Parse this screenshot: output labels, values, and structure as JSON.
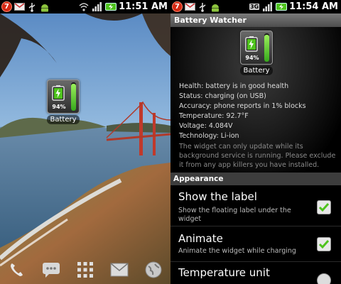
{
  "status_left": {
    "notification_count": "7",
    "time": "11:51 AM"
  },
  "status_right": {
    "notification_count": "7",
    "time": "11:54 AM",
    "network": "3G"
  },
  "widget": {
    "percent": "94%",
    "label": "Battery",
    "level": 0.94
  },
  "app": {
    "title": "Battery Watcher"
  },
  "info": {
    "health": "Health: battery is in good health",
    "status": "Status: charging (on USB)",
    "accuracy": "Accuracy: phone reports in 1% blocks",
    "temperature": "Temperature: 92.7°F",
    "voltage": "Voltage: 4.084V",
    "technology": "Technology: Li-ion",
    "note": "The widget can only update while its background service is running.  Please exclude it from any app killers you have installed."
  },
  "section": {
    "title": "Appearance"
  },
  "prefs": [
    {
      "title": "Show the label",
      "summary": "Show the floating label under the widget",
      "checked": true
    },
    {
      "title": "Animate",
      "summary": "Animate the widget while charging",
      "checked": true
    },
    {
      "title": "Temperature unit",
      "summary": ""
    }
  ],
  "colors": {
    "accent_green": "#4fc31d",
    "notification_red": "#d42a14",
    "battery_green": "#5fd03a"
  }
}
